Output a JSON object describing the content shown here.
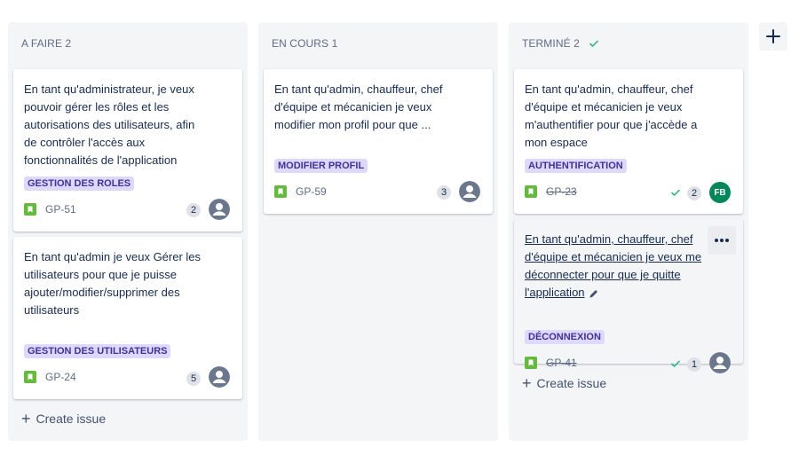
{
  "columns": [
    {
      "title": "A FAIRE 2",
      "create_label": "Create issue",
      "cards": [
        {
          "summary": "En tant qu'administrateur, je veux pouvoir gérer les rôles et les autorisations des utilisateurs, afin de contrôler l'accès aux fonctionnalités de l'application",
          "epic": "GESTION DES ROLES",
          "key": "GP-51",
          "estimate": "2"
        },
        {
          "summary": "En tant qu'admin je veux Gérer les utilisateurs pour que je puisse ajouter/modifier/supprimer des utilisateurs",
          "epic": "GESTION DES UTILISATEURS",
          "key": "GP-24",
          "estimate": "5"
        }
      ]
    },
    {
      "title": "EN COURS 1",
      "cards": [
        {
          "summary": "En tant qu'admin, chauffeur, chef d'équipe et mécanicien je veux modifier mon profil pour que ...",
          "epic": "MODIFIER PROFIL",
          "key": "GP-59",
          "estimate": "3"
        }
      ]
    },
    {
      "title": "TERMINÉ 2",
      "create_label": "Create issue",
      "cards": [
        {
          "summary": "En tant qu'admin, chauffeur, chef d'équipe et mécanicien je veux m'authentifier pour que j'accède a mon espace",
          "epic": "AUTHENTIFICATION",
          "key": "GP-23",
          "estimate": "2",
          "assignee_initials": "FB"
        },
        {
          "summary": "En tant qu'admin, chauffeur, chef d'équipe et mécanicien je veux me déconnecter pour que je quitte l'application",
          "epic": "DÉCONNEXION",
          "key": "GP-41",
          "estimate": "1"
        }
      ]
    }
  ],
  "colors": {
    "column_bg": "#f4f5f7",
    "epic_bg": "#dfd8fd",
    "epic_text": "#403294",
    "story_green": "#63ba3c",
    "done_check": "#36b37e",
    "avatar_fb": "#00875a"
  },
  "icons": {
    "story": "story-bookmark-icon",
    "done": "check-icon",
    "avatar": "default-avatar-icon",
    "more": "more-horizontal-icon",
    "add_column": "plus-icon",
    "edit": "pencil-icon"
  }
}
